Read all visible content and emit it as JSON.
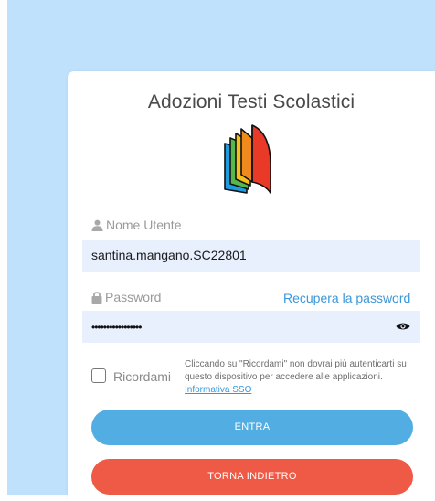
{
  "app": {
    "title": "Adozioni Testi Scolastici"
  },
  "logo": {
    "icon": "book-logo-icon",
    "colors": [
      "#1f9be0",
      "#56b84b",
      "#f6c01a",
      "#f08a1c",
      "#e83a27"
    ]
  },
  "form": {
    "username": {
      "label": "Nome Utente",
      "icon": "user-icon",
      "value": "santina.mangano.SC22801"
    },
    "password": {
      "label": "Password",
      "icon": "lock-icon",
      "value_masked": "•••••••••••••••••",
      "recover_link": "Recupera la password",
      "toggle_icon": "eye-icon"
    },
    "remember": {
      "label": "Ricordami",
      "checked": false,
      "note": "Cliccando su \"Ricordami\" non dovrai più autenticarti su questo dispositivo per accedere alle applicazioni.",
      "note_link": "Informativa SSO"
    }
  },
  "buttons": {
    "enter": "ENTRA",
    "back": "TORNA INDIETRO"
  },
  "colors": {
    "background": "#bfe1fb",
    "input_bg": "#e8f0fe",
    "link": "#3b97d9",
    "enter_button": "#52ade3",
    "back_button": "#ee5a45"
  }
}
